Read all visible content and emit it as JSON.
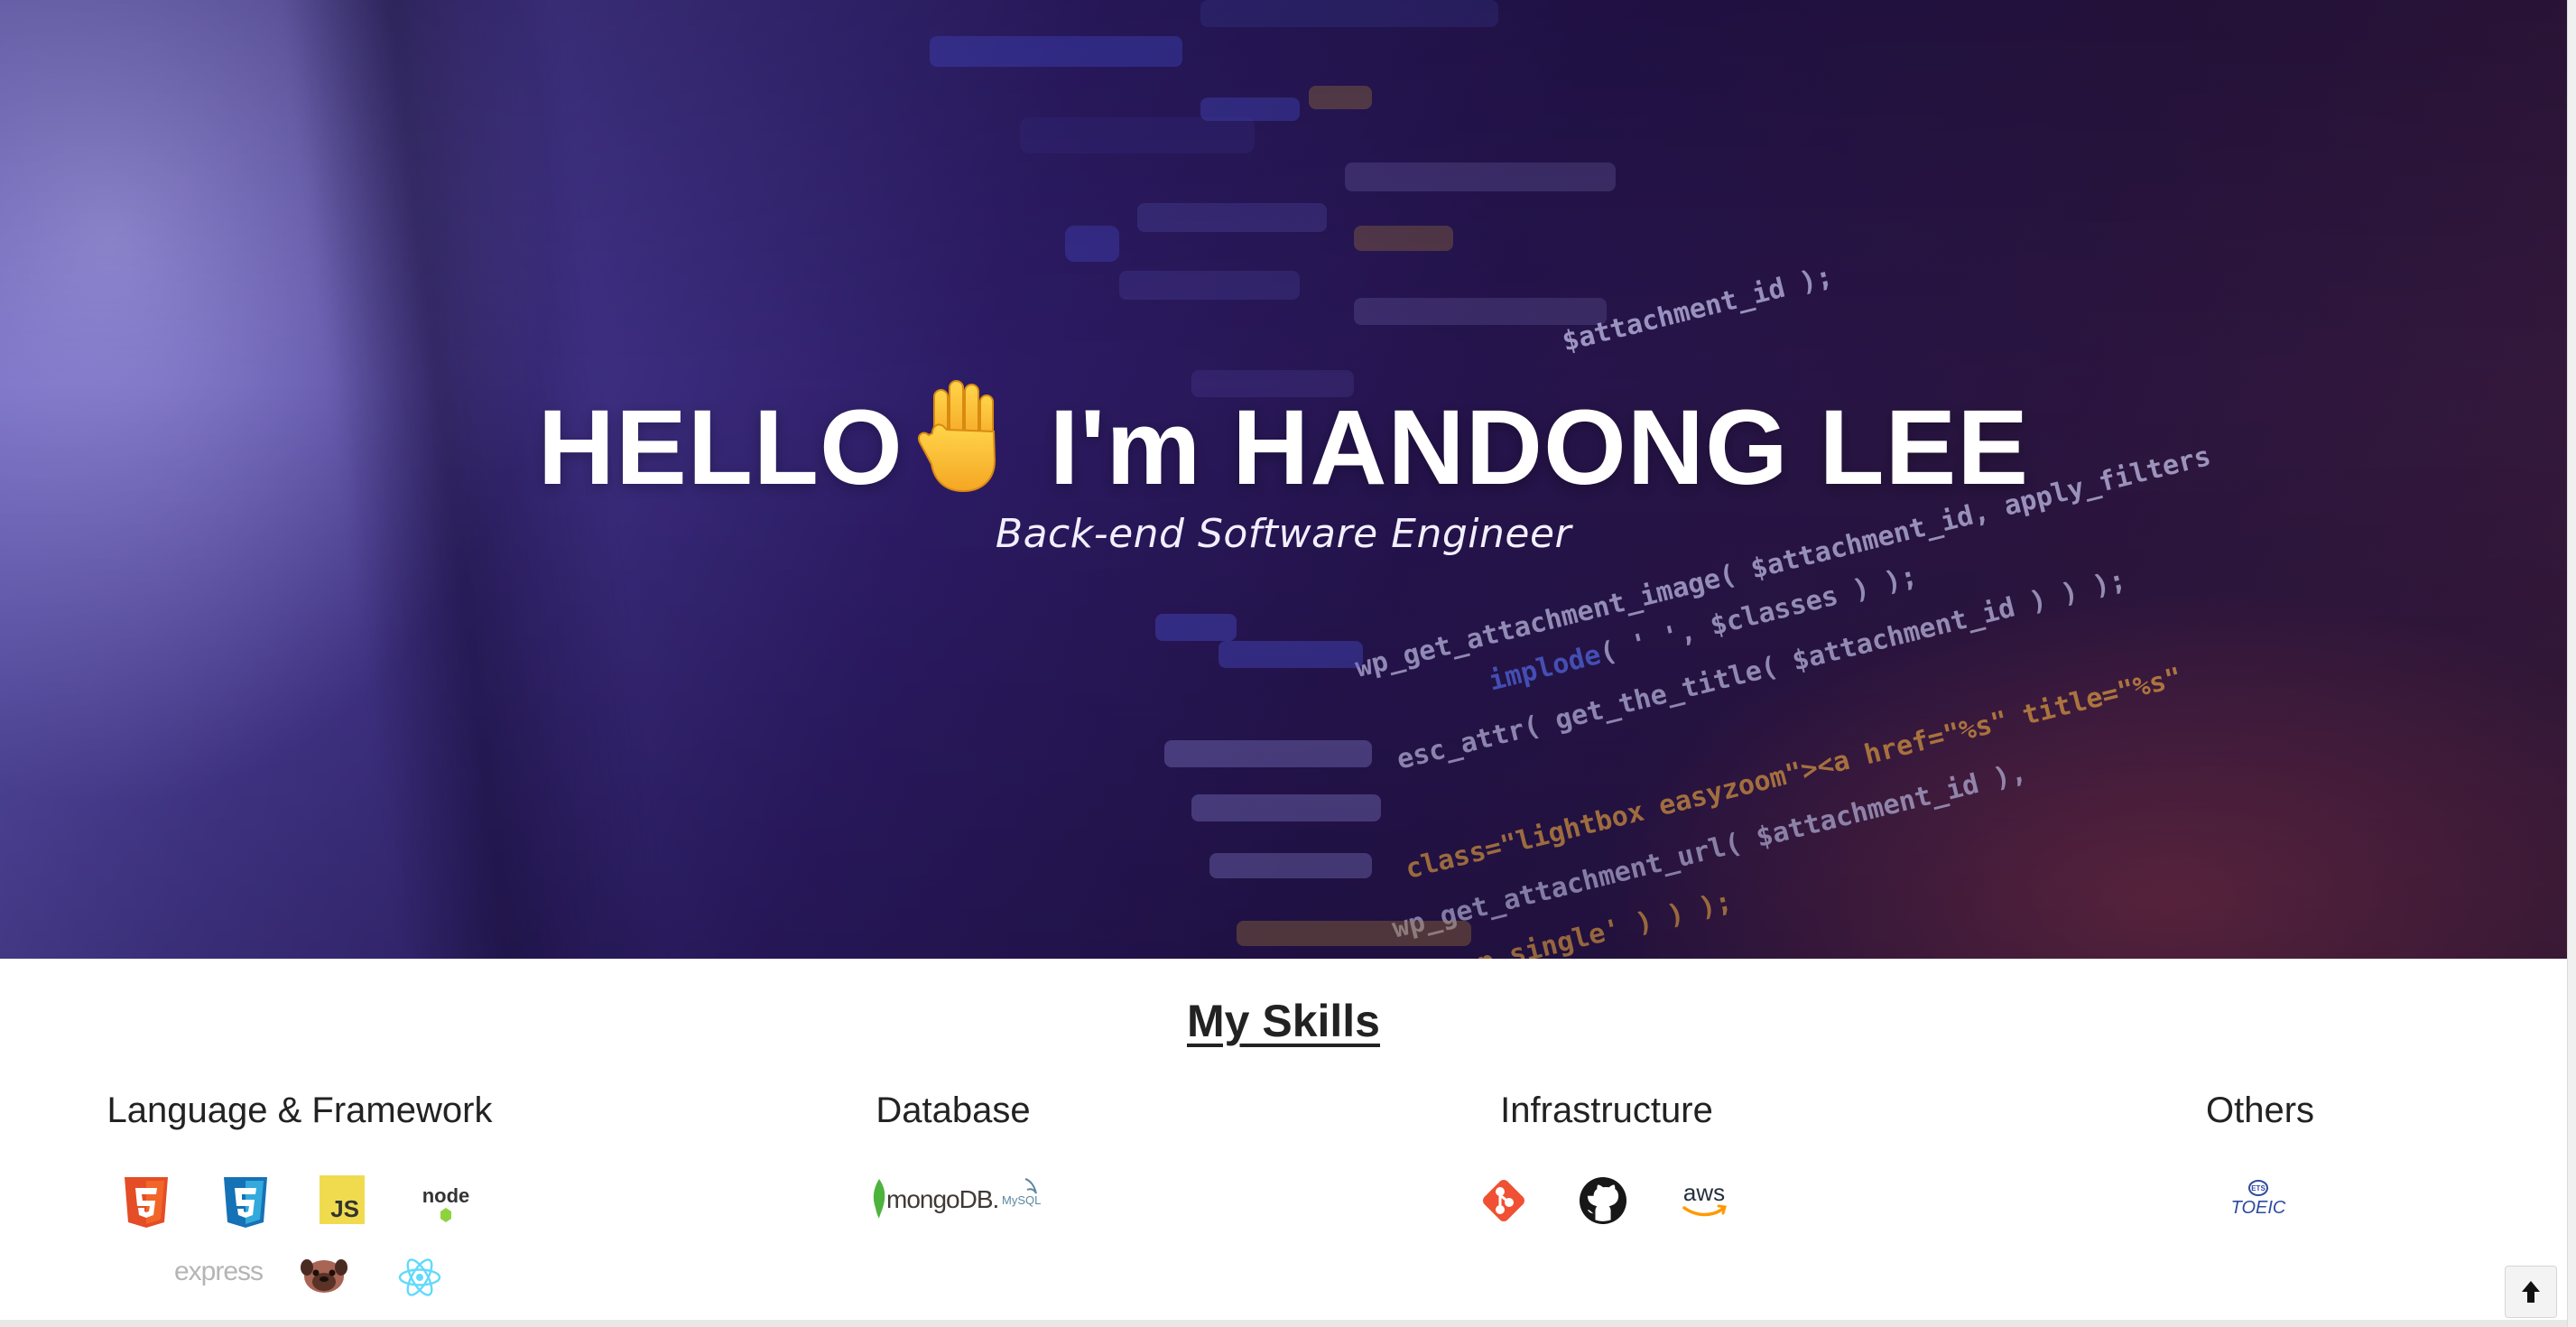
{
  "hero": {
    "title_before": "HELLO",
    "title_after": " I'm HANDONG LEE",
    "hand_icon": "raised-hand-emoji-icon",
    "subtitle": "Back-end Software Engineer",
    "background": "blurred-code-screen-photo",
    "code_snippets": [
      "$attachment_id );",
      "wp_get_attachment_image( $attachment_id, apply_filters",
      "implode( ' ', $classes ) );",
      "get_the_title( $attachment_id ) );",
      "class=\"lightbox easyzoom\"><a href=\"%s\" title=\"%s\"",
      "wp_get_attachment_url( $attachment_id ),",
      "'shop_single' ) ) );"
    ]
  },
  "skills": {
    "title": "My Skills",
    "columns": [
      {
        "heading": "Language & Framework",
        "icons": [
          "html5-icon",
          "css3-icon",
          "javascript-icon",
          "nodejs-icon",
          "express-icon",
          "pug-icon",
          "react-icon"
        ]
      },
      {
        "heading": "Database",
        "icons": [
          "mongodb-icon",
          "mysql-icon"
        ]
      },
      {
        "heading": "Infrastructure",
        "icons": [
          "git-icon",
          "github-icon",
          "aws-icon"
        ]
      },
      {
        "heading": "Others",
        "icons": [
          "toeic-icon"
        ]
      }
    ],
    "logo_text": {
      "js": "JS",
      "node": "node",
      "express": "express",
      "mongodb": "mongoDB.",
      "mysql": "MySQL",
      "aws": "aws",
      "toeic": "TOEIC",
      "ets": "ETS"
    }
  },
  "scroll_top_button": {
    "icon": "arrow-up-icon",
    "glyph": "🡅"
  },
  "colors": {
    "html5": "#e44d26",
    "css3": "#2965f1",
    "javascript": "#f0db4f",
    "react": "#61dafb",
    "mongodb": "#4db33d",
    "git": "#f05033",
    "aws": "#ff9900",
    "toeic": "#2f4a9e"
  }
}
